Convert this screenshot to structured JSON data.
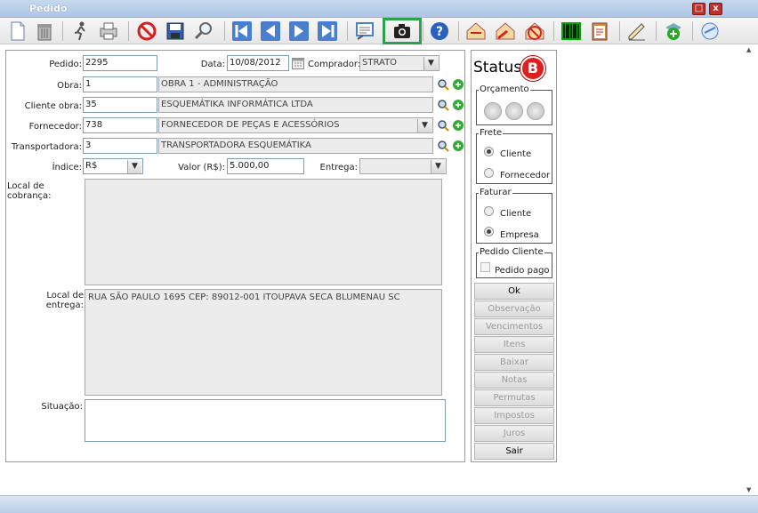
{
  "window": {
    "title": "Pedido"
  },
  "window_buttons": {
    "maximize": "□",
    "close": "x"
  },
  "toolbar": {
    "buttons": [
      "new-document",
      "delete",
      "run",
      "print",
      "cancel",
      "save",
      "search",
      "first",
      "previous",
      "next",
      "last",
      "report",
      "camera",
      "help",
      "send",
      "mail-send",
      "mail-cancel",
      "barcode",
      "clipboard",
      "sign",
      "add-item",
      "sync"
    ]
  },
  "form": {
    "pedido_label": "Pedido:",
    "pedido": "2295",
    "data_label": "Data:",
    "data": "10/08/2012",
    "comprador_label": "Comprador:",
    "comprador": "STRATO",
    "obra_label": "Obra:",
    "obra_code": "1",
    "obra_name": "OBRA 1 - ADMINISTRAÇÃO",
    "cliente_label": "Cliente obra:",
    "cliente_code": "35",
    "cliente_name": "ESQUEMÁTIKA INFORMÁTICA LTDA",
    "fornecedor_label": "Fornecedor:",
    "fornecedor_code": "738",
    "fornecedor_name": "FORNECEDOR DE PEÇAS E ACESSÓRIOS",
    "transportadora_label": "Transportadora:",
    "transportadora_code": "3",
    "transportadora_name": "TRANSPORTADORA ESQUEMÁTIKA",
    "indice_label": "Índice:",
    "indice": "R$",
    "valor_label": "Valor (R$):",
    "valor": "5.000,00",
    "entrega_label": "Entrega:",
    "entrega": "",
    "local_cobranca_label": "Local de cobrança:",
    "local_cobranca": "",
    "local_entrega_label": "Local de entrega:",
    "local_entrega": "RUA SÃO PAULO 1695 CEP: 89012-001 ITOUPAVA SECA BLUMENAU SC",
    "situacao_label": "Situação:",
    "situacao": ""
  },
  "side": {
    "status_label": "Status",
    "status_badge": "B",
    "orcamento_legend": "Orçamento",
    "frete_legend": "Frete",
    "frete_cliente": "Cliente",
    "frete_fornecedor": "Fornecedor",
    "faturar_legend": "Faturar",
    "faturar_cliente": "Cliente",
    "faturar_empresa": "Empresa",
    "pedido_cliente_legend": "Pedido Cliente",
    "pedido_pago": "Pedido pago",
    "buttons": [
      "Ok",
      "Observação",
      "Vencimentos",
      "Itens",
      "Baixar",
      "Notas",
      "Permutas",
      "Impostos",
      "Juros",
      "Sair"
    ]
  },
  "colors": {
    "highlight": "#2aa34a",
    "status_badge": "#e01e1e",
    "title_bar": "#aec6e6"
  }
}
